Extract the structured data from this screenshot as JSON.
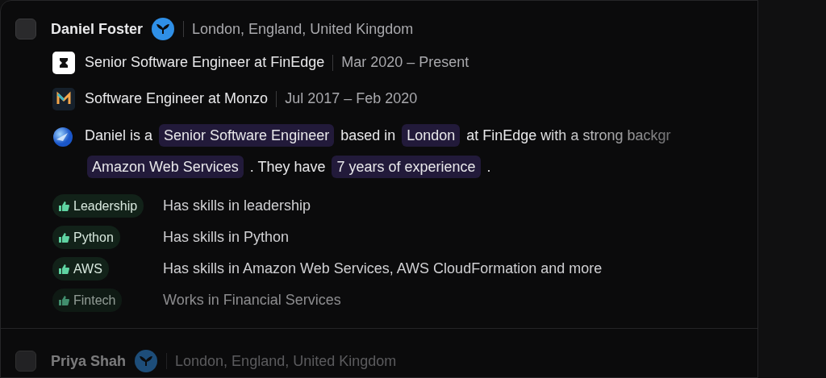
{
  "candidates": [
    {
      "name": "Daniel Foster",
      "location": "London, England, United Kingdom",
      "checked": false,
      "dimmed": false,
      "experience": [
        {
          "title": "Senior Software Engineer at FinEdge",
          "dates": "Mar 2020 – Present",
          "kind": "finedge"
        },
        {
          "title": "Software Engineer at Monzo",
          "dates": "Jul 2017 – Feb 2020",
          "kind": "monzo"
        }
      ],
      "summary": [
        {
          "kind": "text",
          "text": "Daniel is a"
        },
        {
          "kind": "highlight",
          "text": "Senior Software Engineer"
        },
        {
          "kind": "text",
          "text": "based in"
        },
        {
          "kind": "highlight",
          "text": "London"
        },
        {
          "kind": "text",
          "text": "at FinEdge with a strong backgr"
        },
        {
          "kind": "break"
        },
        {
          "kind": "highlight",
          "text": "Amazon Web Services"
        },
        {
          "kind": "text",
          "text": ". They have"
        },
        {
          "kind": "highlight",
          "text": "7 years of experience"
        },
        {
          "kind": "text",
          "text": "."
        }
      ],
      "skills": [
        {
          "tag": "Leadership",
          "reason": "Has skills in leadership"
        },
        {
          "tag": "Python",
          "reason": "Has skills in Python"
        },
        {
          "tag": "AWS",
          "reason": "Has skills in Amazon Web Services, AWS CloudFormation and more"
        },
        {
          "tag": "Fintech",
          "reason": "Works in Financial Services"
        }
      ]
    },
    {
      "name": "Priya Shah",
      "location": "London, England, United Kingdom",
      "checked": false,
      "dimmed": true
    }
  ]
}
